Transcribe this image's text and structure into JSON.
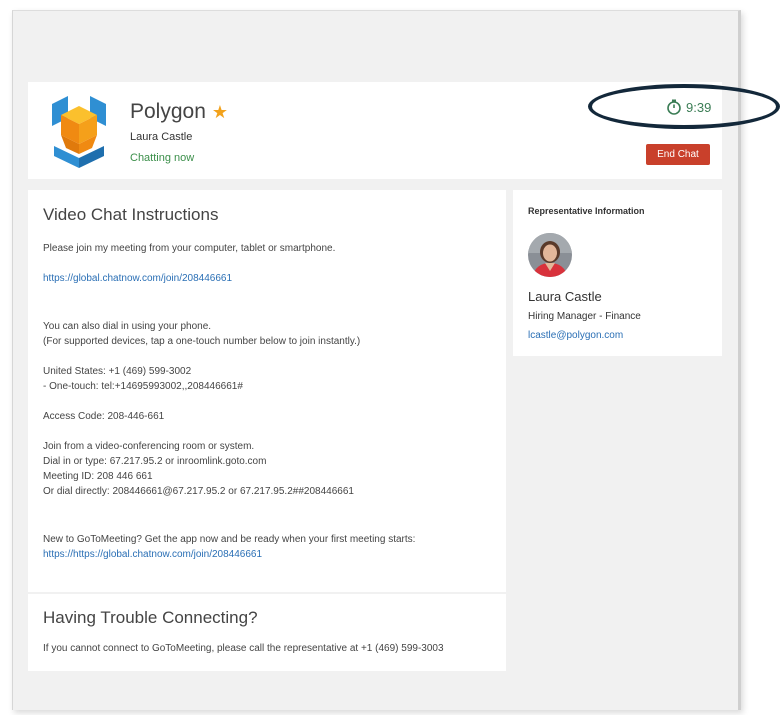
{
  "header": {
    "company_name": "Polygon",
    "rep_name": "Laura Castle",
    "status": "Chatting now",
    "timer": "9:39",
    "end_chat_label": "End Chat"
  },
  "instructions": {
    "title": "Video Chat Instructions",
    "intro": "Please join my meeting from your computer, tablet or smartphone.",
    "join_link": "https://global.chatnow.com/join/208446661",
    "dial_line1": "You can also dial in using your phone.",
    "dial_line2": "(For supported devices, tap a one-touch number below to join instantly.)",
    "us_number": "United States: +1 (469) 599-3002",
    "one_touch": "- One-touch: tel:+14695993002,,208446661#",
    "access_code": "Access Code: 208-446-661",
    "room_line1": "Join from a video-conferencing room or system.",
    "room_line2": "Dial in or type: 67.217.95.2 or inroomlink.goto.com",
    "room_line3": "Meeting ID: 208 446 661",
    "room_line4": "Or dial directly: 208446661@67.217.95.2 or 67.217.95.2##208446661",
    "new_text": "New to GoToMeeting? Get the app now and be ready when your first meeting starts: ",
    "new_link": "https://https://global.chatnow.com/join/208446661"
  },
  "trouble": {
    "title": "Having Trouble Connecting?",
    "text": "If you cannot connect to GoToMeeting, please call the representative at +1 (469) 599-3003"
  },
  "representative": {
    "section_title": "Representative Information",
    "name": "Laura Castle",
    "role": "Hiring Manager - Finance",
    "email": "lcastle@polygon.com"
  },
  "colors": {
    "accent_green": "#3b8f4a",
    "end_chat_red": "#c9402b",
    "link_blue": "#2a6fb5",
    "logo_orange": "#f5a01a",
    "logo_blue": "#2f8fd3"
  }
}
